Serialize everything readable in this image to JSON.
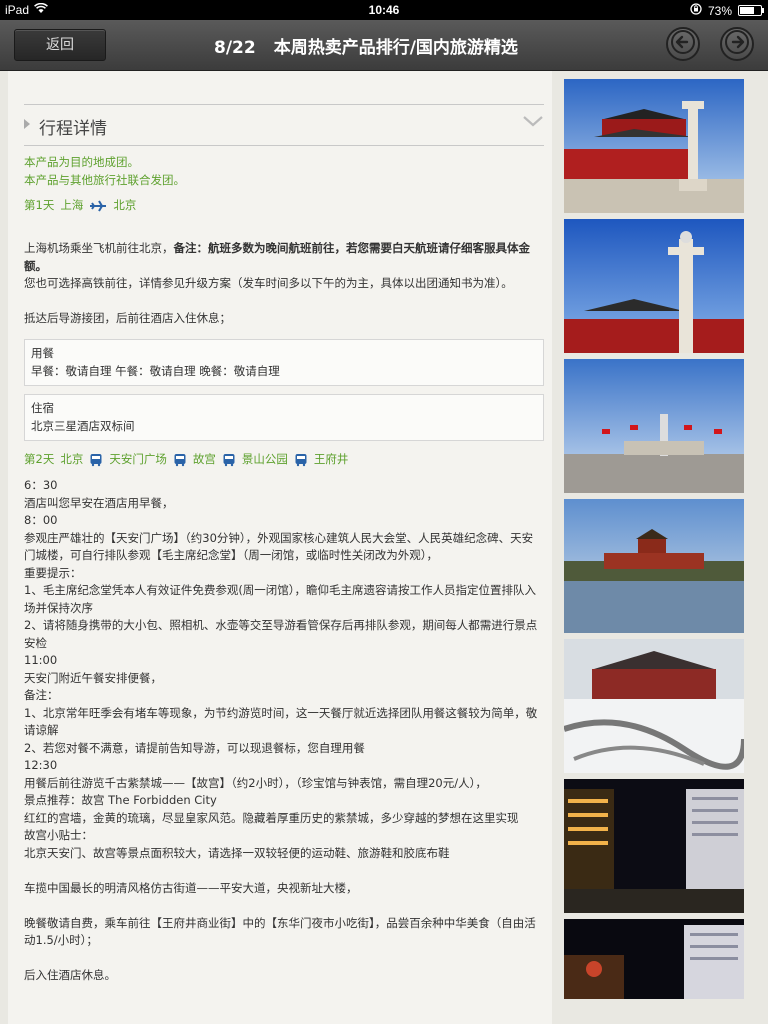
{
  "status": {
    "device": "iPad",
    "time": "10:46",
    "battery": "73%"
  },
  "nav": {
    "back_label": "返回",
    "index": "8/22",
    "title": "本周热卖产品排行/国内旅游精选"
  },
  "section": {
    "title": "行程详情"
  },
  "intro": [
    "本产品为目的地成团。",
    "本产品与其他旅行社联合发团。"
  ],
  "day1": {
    "label": "第1天",
    "from": "上海",
    "to": "北京",
    "p1_a": "上海机场乘坐飞机前往北京，",
    "p1_b": "备注：航班多数为晚间航班前往，若您需要白天航班请仔细客服具体金额。",
    "p2": "您也可选择高铁前往，详情参见升级方案（发车时间多以下午的为主，具体以出团通知书为准）。",
    "p3": "抵达后导游接团，后前往酒店入住休息；",
    "meal_title": "用餐",
    "meal_text": "早餐：敬请自理 午餐：敬请自理 晚餐：敬请自理",
    "stay_title": "住宿",
    "stay_text": "北京三星酒店双标间"
  },
  "day2": {
    "label": "第2天",
    "stops": [
      "北京",
      "天安门广场",
      "故宫",
      "景山公园",
      "王府井"
    ],
    "lines": [
      "6：30",
      "酒店叫您早安在酒店用早餐，",
      "8：00",
      "参观庄严雄壮的【天安门广场】（约30分钟），外观国家核心建筑人民大会堂、人民英雄纪念碑、天安门城楼，可自行排队参观【毛主席纪念堂】（周一闭馆，或临时性关闭改为外观），",
      "重要提示：",
      "1、毛主席纪念堂凭本人有效证件免费参观(周一闭馆），瞻仰毛主席遗容请按工作人员指定位置排队入场并保持次序",
      "2、请将随身携带的大小包、照相机、水壶等交至导游看管保存后再排队参观，期间每人都需进行景点安检",
      "11:00",
      "天安门附近午餐安排便餐，",
      "备注：",
      "1、北京常年旺季会有堵车等现象，为节约游览时间，这一天餐厅就近选择团队用餐这餐较为简单，敬请谅解",
      "2、若您对餐不满意，请提前告知导游，可以现退餐标，您自理用餐",
      "12:30",
      "用餐后前往游览千古紫禁城——【故宫】（约2小时），（珍宝馆与钟表馆，需自理20元/人），",
      "景点推荐：故宫 The Forbidden City",
      "红红的宫墙，金黄的琉璃，尽显皇家风范。隐藏着厚重历史的紫禁城，多少穿越的梦想在这里实现",
      "故宫小贴士：",
      "北京天安门、故宫等景点面积较大，请选择一双较轻便的运动鞋、旅游鞋和胶底布鞋",
      "",
      "车揽中国最长的明清风格仿古街道——平安大道，央视新址大楼，",
      "",
      "晚餐敬请自费，乘车前往【王府井商业街】中的【东华门夜市小吃街】，品尝百余种中华美食（自由活动1.5/小时）；",
      "",
      "后入住酒店休息。"
    ]
  },
  "photos": [
    "tiananmen-gate-with-column",
    "huabiao-column-and-gate",
    "tiananmen-square-flags",
    "forbidden-city-corner-tower",
    "forbidden-city-snow",
    "wangfujing-street-night",
    "wangfujing-night-buildings"
  ]
}
